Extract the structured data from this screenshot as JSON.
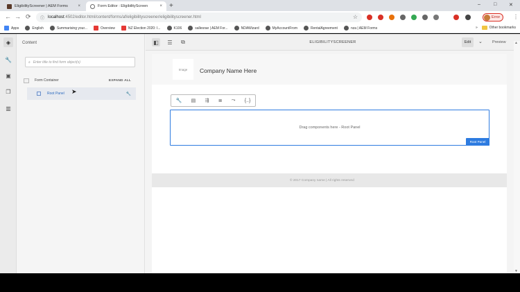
{
  "browser": {
    "tabs": [
      {
        "title": "EligibilityScreener | AEM Forms",
        "close": "×"
      },
      {
        "title": "Form Editor : EligibilityScreen",
        "close": "×"
      }
    ],
    "new_tab": "+",
    "window_controls": {
      "minimize": "–",
      "maximize": "□",
      "close": "✕"
    },
    "nav": {
      "back": "←",
      "forward": "→",
      "reload": "⟳"
    },
    "url_host": "localhost",
    "url_path": ":4502/editor.html/content/forms/af/eligibilityscreener/eligibilityscreener.html",
    "lock": "ⓘ",
    "star": "☆",
    "profile_status": "Error",
    "menu": "⋮",
    "extension_colors": [
      "#d93025",
      "#d93025",
      "#e8710a",
      "#666666",
      "#34a853",
      "#666666",
      "#777777",
      "#d93025",
      "#444444"
    ]
  },
  "bookmarks": {
    "items": [
      {
        "label": "Apps",
        "color": "#4285f4"
      },
      {
        "label": "English",
        "color": "#555555"
      },
      {
        "label": "Summarising your...",
        "color": "#555555"
      },
      {
        "label": "Overview",
        "color": "#e53935"
      },
      {
        "label": "NZ Election 2020: I...",
        "color": "#e53935"
      },
      {
        "label": "K106",
        "color": "#555555"
      },
      {
        "label": "sallesrae | AEM For...",
        "color": "#555555"
      },
      {
        "label": "NDAWizard",
        "color": "#555555"
      },
      {
        "label": "MyAccountFrom",
        "color": "#555555"
      },
      {
        "label": "RentalAgreement",
        "color": "#555555"
      },
      {
        "label": "nza | AEM Forms",
        "color": "#555555"
      }
    ],
    "more": "»",
    "other": "Other bookmarks"
  },
  "editor": {
    "rail_icons": [
      "layers-icon",
      "wrench-icon",
      "assets-icon",
      "copy-icon",
      "library-icon"
    ],
    "side_panel": {
      "title": "Content",
      "search_placeholder": "Enter title to find form object(s)",
      "search_icon": "⌕",
      "tree_header": "Form Container",
      "expand_all": "EXPAND ALL",
      "root_item": "Root Panel",
      "root_action": "🔧"
    },
    "topbar": {
      "doc_title": "ELIGIBILITYSCREENER",
      "edit_label": "Edit",
      "caret": "⌄",
      "preview_label": "Preview"
    },
    "page": {
      "logo_text": "Image",
      "company_name": "Company Name Here",
      "toolbar_glyphs": [
        "🔧",
        "▤",
        "⇶",
        "≣",
        "⤳",
        "{..}"
      ],
      "dropzone_text": "Drag components here - Root Panel",
      "dropzone_label": "Root Panel",
      "footer_text": "© 2017 Company name | All rights reserved"
    },
    "accent_color": "#2d7be0"
  }
}
